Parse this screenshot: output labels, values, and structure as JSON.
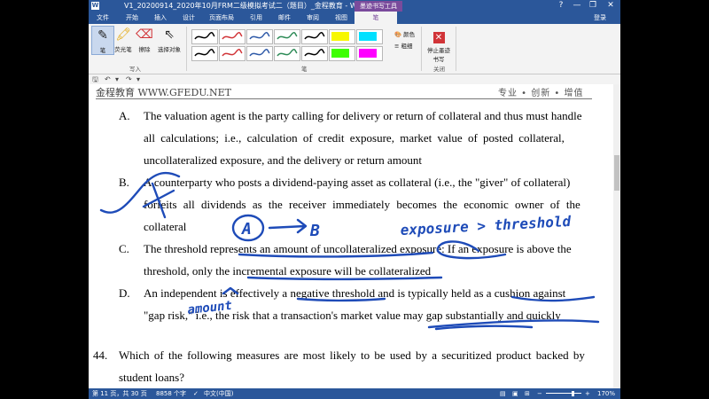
{
  "titlebar": {
    "title": "V1_20200914_2020年10月FRM二级模拟考试二（题目）_金程教育 - Word",
    "context_tab": "墨迹书写工具",
    "icon": "W",
    "help": "?",
    "minimize": "—",
    "restore": "❐",
    "close": "✕"
  },
  "tabs": [
    {
      "label": "文件"
    },
    {
      "label": "开始"
    },
    {
      "label": "插入"
    },
    {
      "label": "设计"
    },
    {
      "label": "页面布局"
    },
    {
      "label": "引用"
    },
    {
      "label": "邮件"
    },
    {
      "label": "审阅"
    },
    {
      "label": "视图"
    },
    {
      "label": "笔"
    }
  ],
  "login": "登录",
  "ribbon": {
    "pen_label": "笔",
    "highlighter_label": "荧光笔",
    "eraser_label": "擦除",
    "select_label": "选择对象",
    "group_write": "写入",
    "group_pens": "笔",
    "color_label": "颜色",
    "thickness_label": "粗细",
    "stop_label": "停止墨迹书写",
    "group_close": "关闭",
    "pen_colors": [
      "#000000",
      "#d13438",
      "#2f5aa8",
      "#2e8b57",
      "#000000",
      "#f7f700",
      "#00e0ff",
      "#000000",
      "#d13438",
      "#2f5aa8",
      "#2e8b57",
      "#000000",
      "#3cff00",
      "#ff00ff"
    ]
  },
  "qat": {
    "save": "🖫",
    "undo": "↶",
    "redo": "↷",
    "more": "▾"
  },
  "document": {
    "header_left": "金程教育 WWW.GFEDU.NET",
    "header_right": "专业 • 创新 • 增值",
    "options": [
      {
        "label": "A.",
        "lines": [
          "The valuation agent is the party calling for delivery or return of collateral and thus must handle",
          "all calculations; i.e., calculation of credit exposure, market value of posted collateral,",
          "uncollateralized exposure, and the delivery or return amount"
        ]
      },
      {
        "label": "B.",
        "lines": [
          "A counterparty who posts a dividend-paying asset as collateral (i.e., the \"giver\" of collateral)",
          "forfeits all dividends as the receiver immediately becomes the economic owner of the",
          "collateral"
        ]
      },
      {
        "label": "C.",
        "lines": [
          "The threshold represents an amount of uncollateralized exposure: If an exposure is above the",
          "threshold, only the incremental exposure will be collateralized"
        ]
      },
      {
        "label": "D.",
        "lines": [
          "An independent is effectively a negative threshold and is typically held as a cushion against",
          "\"gap risk,\" i.e., the risk that a transaction's market value may gap substantially and quickly"
        ]
      }
    ],
    "question": {
      "number": "44.",
      "lines": [
        "Which of the following measures are most likely to be used by a securitized product backed by",
        "student loans?"
      ]
    },
    "annotations": {
      "a_to_b_a": "A",
      "a_to_b_b": "B",
      "exposure_threshold": "exposure > threshold",
      "amount": "amount"
    },
    "ink_color": "#1e4bb8"
  },
  "status": {
    "page": "第 11 页，共 30 页",
    "words": "8858 个字",
    "language": "中文(中国)",
    "zoom": "170%"
  }
}
